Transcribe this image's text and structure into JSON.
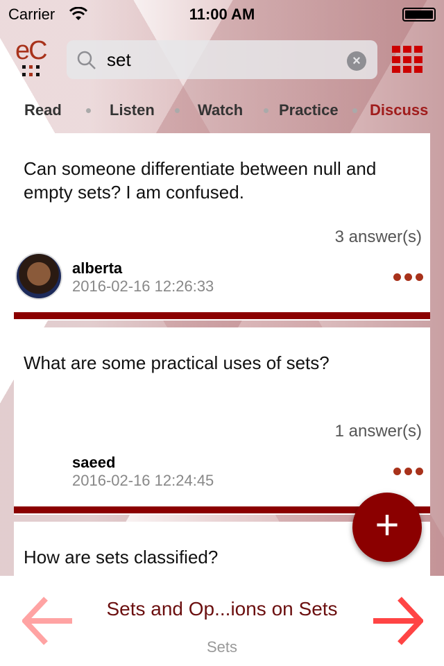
{
  "status": {
    "carrier": "Carrier",
    "time": "11:00 AM"
  },
  "header": {
    "logo_text": "eC",
    "search": {
      "value": "set",
      "placeholder": "Search"
    }
  },
  "tabs": [
    {
      "label": "Read"
    },
    {
      "label": "Listen"
    },
    {
      "label": "Watch"
    },
    {
      "label": "Practice"
    },
    {
      "label": "Discuss",
      "active": true
    }
  ],
  "posts": [
    {
      "question": "Can someone differentiate between null and empty sets? I am confused.",
      "answers": "3 answer(s)",
      "user": "alberta",
      "date": "2016-02-16 12:26:33",
      "has_avatar": true
    },
    {
      "question": "What are some practical uses of sets?",
      "answers": "1 answer(s)",
      "user": "saeed",
      "date": "2016-02-16 12:24:45",
      "has_avatar": false
    },
    {
      "question": "How are sets classified?"
    }
  ],
  "fab": {
    "label": "+"
  },
  "footer": {
    "title": "Sets and Op...ions on Sets",
    "subtitle": "Sets"
  },
  "colors": {
    "accent": "#8b0000",
    "active_tab": "#a01c1c",
    "logo": "#a8321b"
  }
}
